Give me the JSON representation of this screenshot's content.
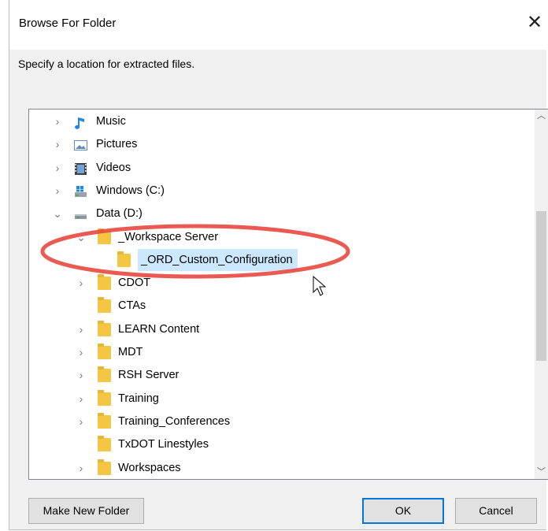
{
  "dialog": {
    "title": "Browse For Folder",
    "close_label": "✕",
    "instruction": "Specify a location for extracted files."
  },
  "tree": {
    "items": [
      {
        "label": "Music",
        "icon": "music-icon",
        "expander": "collapsed"
      },
      {
        "label": "Pictures",
        "icon": "pictures-icon",
        "expander": "collapsed"
      },
      {
        "label": "Videos",
        "icon": "videos-icon",
        "expander": "collapsed"
      },
      {
        "label": "Windows (C:)",
        "icon": "windows-drive-icon",
        "expander": "collapsed"
      },
      {
        "label": "Data (D:)",
        "icon": "drive-icon",
        "expander": "expanded"
      },
      {
        "label": "_Workspace Server",
        "icon": "folder-icon",
        "expander": "expanded"
      },
      {
        "label": "_ORD_Custom_Configuration",
        "icon": "folder-icon",
        "expander": "none",
        "selected": true
      },
      {
        "label": "CDOT",
        "icon": "folder-icon",
        "expander": "collapsed"
      },
      {
        "label": "CTAs",
        "icon": "folder-icon",
        "expander": "none"
      },
      {
        "label": "LEARN Content",
        "icon": "folder-icon",
        "expander": "collapsed"
      },
      {
        "label": "MDT",
        "icon": "folder-icon",
        "expander": "collapsed"
      },
      {
        "label": "RSH Server",
        "icon": "folder-icon",
        "expander": "collapsed"
      },
      {
        "label": "Training",
        "icon": "folder-icon",
        "expander": "collapsed"
      },
      {
        "label": "Training_Conferences",
        "icon": "folder-icon",
        "expander": "collapsed"
      },
      {
        "label": "TxDOT Linestyles",
        "icon": "folder-icon",
        "expander": "none"
      },
      {
        "label": "Workspaces",
        "icon": "folder-icon",
        "expander": "collapsed"
      }
    ]
  },
  "buttons": {
    "make_new_folder": "Make New Folder",
    "ok": "OK",
    "cancel": "Cancel"
  },
  "colors": {
    "selection": "#cce8ff",
    "annotation_ring": "#e8483f",
    "default_button_border": "#0078d7"
  }
}
